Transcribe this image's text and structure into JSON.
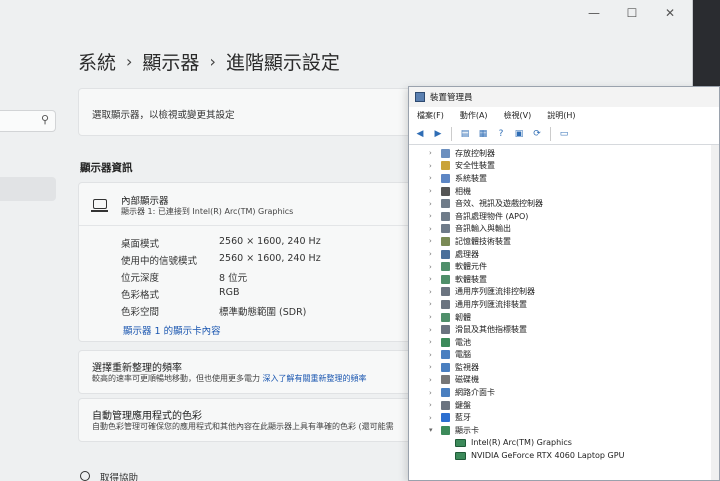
{
  "settings": {
    "window_controls": [
      "—",
      "☐",
      "✕"
    ],
    "breadcrumb": [
      "系統",
      "顯示器",
      "進階顯示設定"
    ],
    "breadcrumb_sep": "›",
    "search_icon": "search-icon",
    "select_display_label": "選取顯示器，以檢視或變更其設定",
    "section_title": "顯示器資訊",
    "display": {
      "name": "內部顯示器",
      "subtitle": "顯示器 1: 已連接到 Intel(R) Arc(TM) Graphics",
      "properties": [
        {
          "label": "桌面模式",
          "value": "2560 × 1600, 240 Hz"
        },
        {
          "label": "使用中的信號模式",
          "value": "2560 × 1600, 240 Hz"
        },
        {
          "label": "位元深度",
          "value": "8 位元"
        },
        {
          "label": "色彩格式",
          "value": "RGB"
        },
        {
          "label": "色彩空間",
          "value": "標準動態範圍 (SDR)"
        }
      ],
      "adapter_link": "顯示器 1 的顯示卡內容"
    },
    "refresh": {
      "title": "選擇重新整理的頻率",
      "desc": "較高的速率可更順暢地移動，但也使用更多電力",
      "link": "深入了解有關重新整理的頻率"
    },
    "color": {
      "title": "自動管理應用程式的色彩",
      "desc": "自動色彩管理可確保您的應用程式和其他內容在此顯示器上具有準確的色彩 (還可能需"
    },
    "help_label": "取得協助"
  },
  "devmgr": {
    "title": "裝置管理員",
    "menu": [
      "檔案(F)",
      "動作(A)",
      "檢視(V)",
      "說明(H)"
    ],
    "tree": [
      {
        "label": "存放控制器",
        "color": "#6b8fbf"
      },
      {
        "label": "安全性裝置",
        "color": "#c9a33b"
      },
      {
        "label": "系統裝置",
        "color": "#5d86c4"
      },
      {
        "label": "相機",
        "color": "#555555"
      },
      {
        "label": "音效、視訊及遊戲控制器",
        "color": "#6f7b89"
      },
      {
        "label": "音訊處理物件 (APO)",
        "color": "#6f7b89"
      },
      {
        "label": "音訊輸入與輸出",
        "color": "#6f7b89"
      },
      {
        "label": "記憶體技術裝置",
        "color": "#7a8a55"
      },
      {
        "label": "處理器",
        "color": "#4a6f9a"
      },
      {
        "label": "軟體元件",
        "color": "#4f8f6a"
      },
      {
        "label": "軟體裝置",
        "color": "#4f8f6a"
      },
      {
        "label": "通用序列匯流排控制器",
        "color": "#6b7480"
      },
      {
        "label": "通用序列匯流排裝置",
        "color": "#6b7480"
      },
      {
        "label": "韌體",
        "color": "#4f8f6a"
      },
      {
        "label": "滑鼠及其他指標裝置",
        "color": "#6b7480"
      },
      {
        "label": "電池",
        "color": "#3c8a5a"
      },
      {
        "label": "電腦",
        "color": "#4a7fc0"
      },
      {
        "label": "監視器",
        "color": "#4a7fc0"
      },
      {
        "label": "磁碟機",
        "color": "#777777"
      },
      {
        "label": "網路介面卡",
        "color": "#4a7fc0"
      },
      {
        "label": "鍵盤",
        "color": "#6b7480"
      },
      {
        "label": "藍牙",
        "color": "#2d6fd0"
      },
      {
        "label": "顯示卡",
        "color": "#3c8a5a",
        "expanded": true
      }
    ],
    "display_adapters": [
      "Intel(R) Arc(TM) Graphics",
      "NVIDIA GeForce RTX 4060 Laptop GPU"
    ]
  }
}
